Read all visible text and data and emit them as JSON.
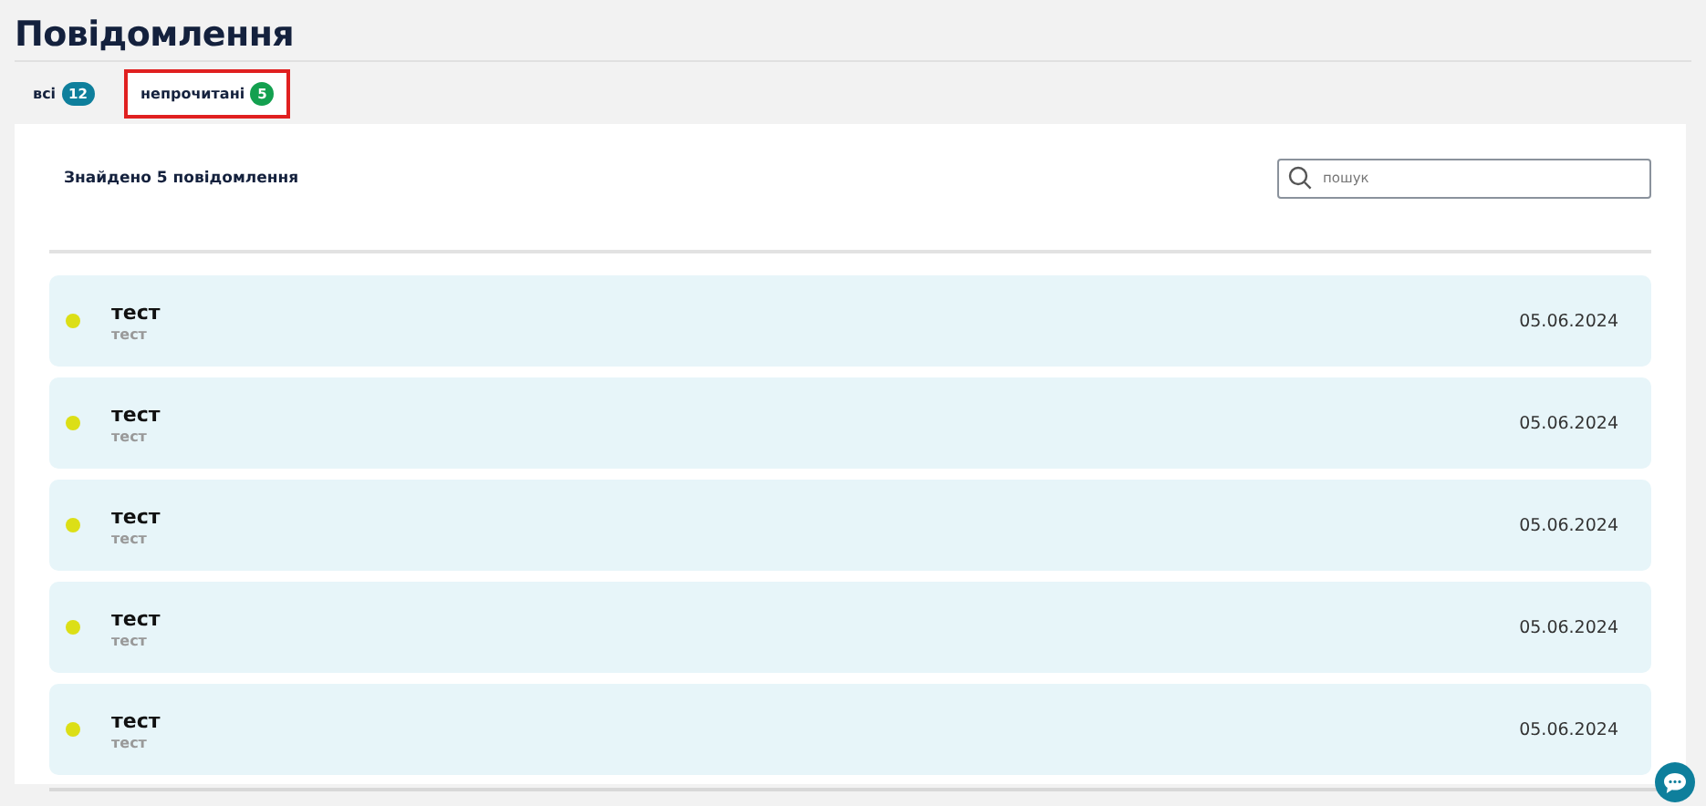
{
  "title": "Повідомлення",
  "tabs": [
    {
      "label": "всі",
      "count": "12",
      "color": "#0e7f9c",
      "selected": false
    },
    {
      "label": "непрочитані",
      "count": "5",
      "color": "#13a04f",
      "selected": true
    }
  ],
  "result_text": "Знайдено 5 повідомлення",
  "search": {
    "placeholder": "пошук"
  },
  "messages": [
    {
      "title": "тест",
      "subtitle": "тест",
      "date": "05.06.2024",
      "unread": true
    },
    {
      "title": "тест",
      "subtitle": "тест",
      "date": "05.06.2024",
      "unread": true
    },
    {
      "title": "тест",
      "subtitle": "тест",
      "date": "05.06.2024",
      "unread": true
    },
    {
      "title": "тест",
      "subtitle": "тест",
      "date": "05.06.2024",
      "unread": true
    },
    {
      "title": "тест",
      "subtitle": "тест",
      "date": "05.06.2024",
      "unread": true
    }
  ]
}
